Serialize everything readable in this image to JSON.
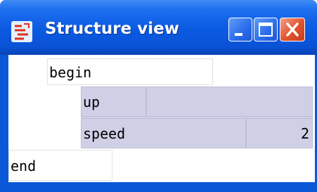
{
  "window": {
    "title": "Structure view",
    "icon": "structure-app-icon",
    "buttons": [
      "minimize-icon",
      "maximize-icon",
      "close-icon"
    ],
    "colors": {
      "titlebar": "#0a5ae2",
      "close_button": "#e1522c",
      "block_fill": "#cfcfe6"
    }
  },
  "structure": {
    "begin": "begin",
    "up": "up",
    "speed": "speed",
    "speed_value": "2",
    "end": "end"
  }
}
